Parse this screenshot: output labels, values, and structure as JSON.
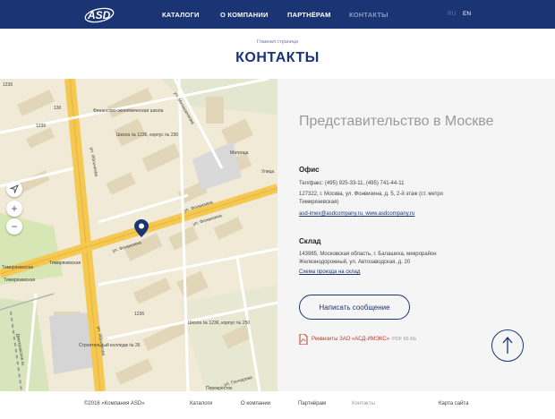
{
  "header": {
    "logo_text": "ASD",
    "nav": [
      {
        "label": "КАТАЛОГИ"
      },
      {
        "label": "О КОМПАНИИ"
      },
      {
        "label": "ПАРТНЁРАМ"
      },
      {
        "label": "КОНТАКТЫ"
      }
    ],
    "lang": {
      "ru": "RU",
      "en": "EN"
    }
  },
  "breadcrumb": "Главная страница",
  "page_title": "КОНТАКТЫ",
  "map": {
    "labels": {
      "street_fonvizina_1": "ул. Фонвизина",
      "street_fonvizina_2": "ул. Фонвизина",
      "street_fonvizina_3": "ул. Фонвизина",
      "street_milashenkova": "ул. Милашенкова",
      "street_dmitrovskoe": "Дмитровское ш.",
      "street_goncharova": "ул. Гончарова",
      "street_yablochkova": "ул. Яблочкова",
      "street_yablochkova2": "ул. Яблочкова",
      "timiryazevskaya_1": "Тимирязевская",
      "timiryazevskaya_2": "Тимирязевская",
      "timiryazevskaya_3": "Тимирязевская",
      "school_1": "Школа № 1236, корпус № 230",
      "school_2": "Школа № 1236, корпус № 250",
      "college": "Финансово-экономическая школа",
      "metrika": "Матрица",
      "ulitsa": "Улица",
      "college2": "Строительный колледж № 26",
      "perekrestok": "Перекрёсток",
      "n1236a": "1236",
      "n1236b": "1236",
      "n1236c": "1236",
      "n130": "130"
    }
  },
  "contacts": {
    "title": "Представительство в Москве",
    "office": {
      "heading": "Офис",
      "phone": "Тел/факс: (495) 925-33-11, (495) 741-44-11",
      "address": "127322, г. Москва, ул. Фонвизина, д. 5, 2-й этаж (ст. метро Тимирязевская)",
      "links": "asd-imex@asdcompany.ru, www.asdcompany.ru"
    },
    "warehouse": {
      "heading": "Склад",
      "address": "143985, Московская область, г. Балашиха, микрорайон Железнодорожный, ул. Автозаводская, д. 20",
      "map_link": "Схема проезда на склад"
    },
    "write_button": "Написать сообщение",
    "pdf": {
      "label": "Реквизиты ЗАО «АСД-ИМЭКС»",
      "size": "PDF 65 Kb"
    }
  },
  "footer": {
    "copyright": "©2016 «Компания ASD»",
    "links": [
      "Каталоги",
      "О компании",
      "Партнёрам",
      "Контакты",
      "Карта сайта"
    ]
  },
  "colors": {
    "brand": "#1b3473",
    "pdf_red": "#c0392b",
    "map_road": "#f5c951"
  },
  "icons": [
    "location-arrow-icon",
    "zoom-in-icon",
    "zoom-out-icon",
    "map-pin-icon",
    "pdf-icon",
    "arrow-up-icon"
  ]
}
